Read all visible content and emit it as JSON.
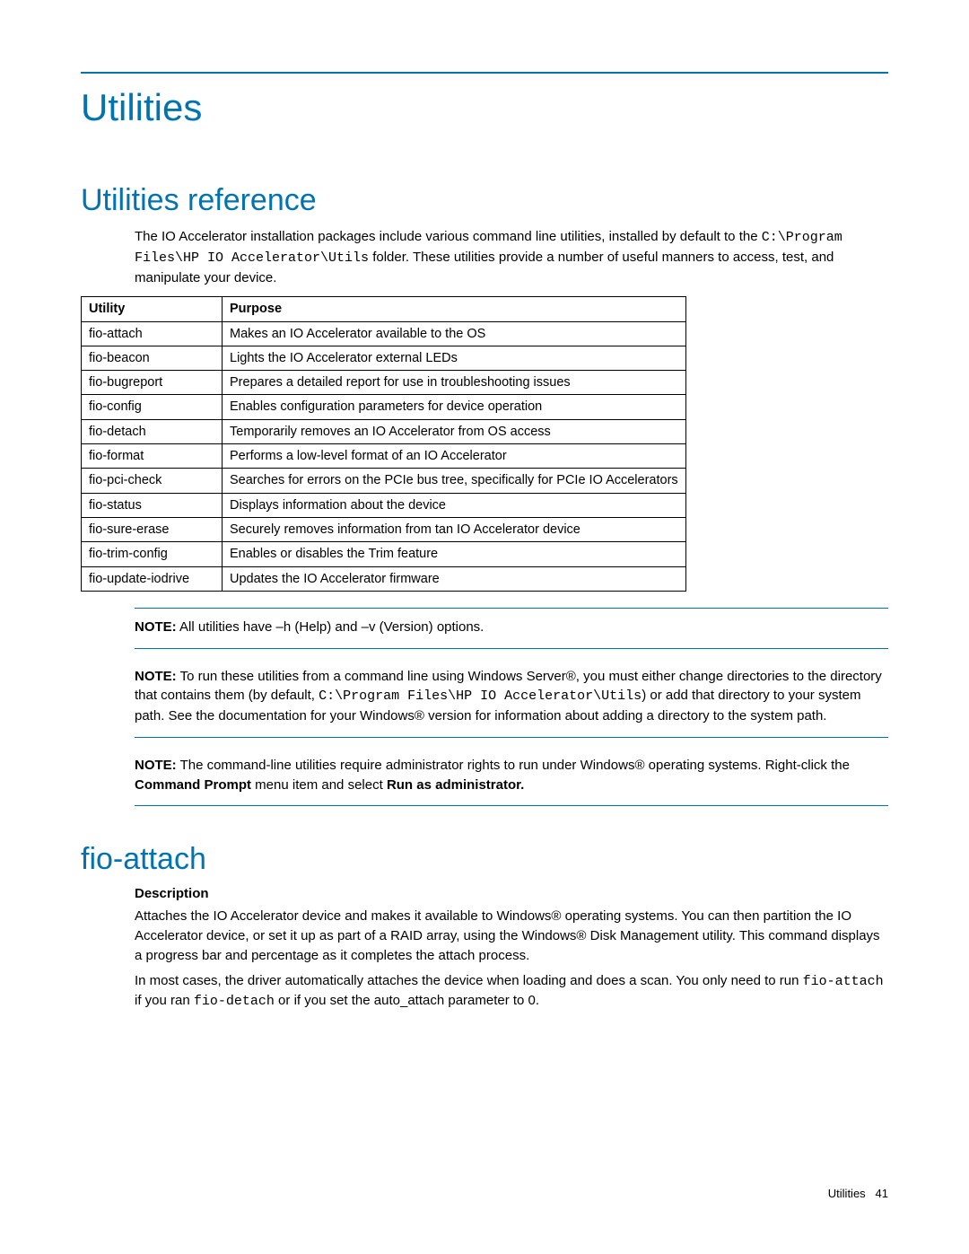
{
  "page_title": "Utilities",
  "section1": {
    "heading": "Utilities reference",
    "intro_pre": "The IO Accelerator installation packages include various command line utilities, installed by default to the ",
    "intro_code": "C:\\Program Files\\HP IO Accelerator\\Utils",
    "intro_post": " folder. These utilities provide a number of useful manners to access, test, and manipulate your device.",
    "table": {
      "head_utility": "Utility",
      "head_purpose": "Purpose",
      "rows": [
        {
          "u": "fio-attach",
          "p": "Makes an IO Accelerator available to the OS"
        },
        {
          "u": "fio-beacon",
          "p": "Lights the IO Accelerator external LEDs"
        },
        {
          "u": "fio-bugreport",
          "p": "Prepares a detailed report for use in troubleshooting issues"
        },
        {
          "u": "fio-config",
          "p": "Enables configuration parameters for device operation"
        },
        {
          "u": "fio-detach",
          "p": "Temporarily removes an IO Accelerator from OS access"
        },
        {
          "u": "fio-format",
          "p": "Performs a low-level format of an IO Accelerator"
        },
        {
          "u": "fio-pci-check",
          "p": "Searches for errors on the PCIe bus tree, specifically for PCIe IO Accelerators"
        },
        {
          "u": "fio-status",
          "p": "Displays information about the device"
        },
        {
          "u": "fio-sure-erase",
          "p": "Securely removes information from tan IO Accelerator device"
        },
        {
          "u": "fio-trim-config",
          "p": "Enables or disables the Trim feature"
        },
        {
          "u": "fio-update-iodrive",
          "p": "Updates the IO Accelerator firmware"
        }
      ]
    },
    "note1_label": "NOTE:",
    "note1_text": "  All utilities have –h (Help) and –v (Version) options.",
    "note2_label": "NOTE:",
    "note2_pre": "  To run these utilities from a command line using Windows Server®, you must either change directories to the directory that contains them (by default, ",
    "note2_code": "C:\\Program Files\\HP IO Accelerator\\Utils",
    "note2_post": ") or add that directory to your system path. See the documentation for your Windows® version for information about adding a directory to the system path.",
    "note3_label": "NOTE:",
    "note3_pre": "  The command-line utilities require administrator rights to run under Windows® operating systems. Right-click the ",
    "note3_b1": "Command Prompt",
    "note3_mid": " menu item and select ",
    "note3_b2": "Run as administrator."
  },
  "section2": {
    "heading": "fio-attach",
    "subhead": "Description",
    "para1": "Attaches the IO Accelerator device and makes it available to Windows® operating systems. You can then partition the IO Accelerator device, or set it up as part of a RAID array, using the Windows® Disk Management utility. This command displays a progress bar and percentage as it completes the attach process.",
    "para2_pre": "In most cases, the driver automatically attaches the device when loading and does a scan. You only need to run ",
    "para2_code1": "fio-attach",
    "para2_mid": " if you ran ",
    "para2_code2": "fio-detach",
    "para2_post": " or if you set the auto_attach parameter to 0."
  },
  "footer": {
    "section": "Utilities",
    "page": "41"
  }
}
